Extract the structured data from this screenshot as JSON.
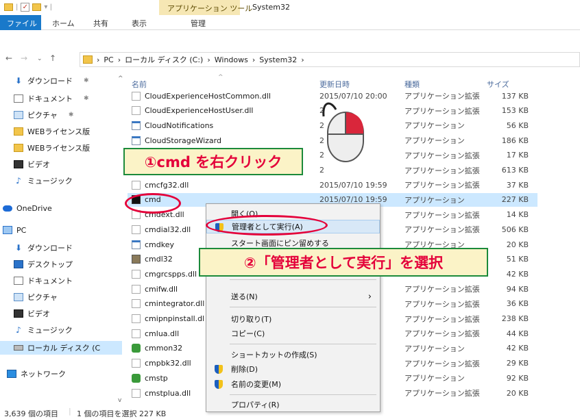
{
  "titlebar": {
    "context_tab": "アプリケーション ツール",
    "window_title": "System32"
  },
  "ribbon": {
    "tabs": [
      "ファイル",
      "ホーム",
      "共有",
      "表示",
      "管理"
    ]
  },
  "address": {
    "crumbs": [
      "PC",
      "ローカル ディスク (C:)",
      "Windows",
      "System32"
    ]
  },
  "sidebar": {
    "items": [
      {
        "label": "ダウンロード",
        "icon": "download-icon",
        "pinned": true
      },
      {
        "label": "ドキュメント",
        "icon": "document-icon",
        "pinned": true
      },
      {
        "label": "ピクチャ",
        "icon": "picture-icon",
        "pinned": true
      },
      {
        "label": "WEBライセンス版",
        "icon": "folder-icon",
        "pinned": false
      },
      {
        "label": "WEBライセンス版",
        "icon": "folder-icon",
        "pinned": false
      },
      {
        "label": "ビデオ",
        "icon": "video-icon",
        "pinned": false
      },
      {
        "label": "ミュージック",
        "icon": "music-icon",
        "pinned": false
      },
      {
        "label": "OneDrive",
        "icon": "onedrive-icon",
        "pinned": false
      },
      {
        "label": "PC",
        "icon": "pc-icon",
        "pinned": false
      },
      {
        "label": "ダウンロード",
        "icon": "download-icon",
        "pinned": false
      },
      {
        "label": "デスクトップ",
        "icon": "desktop-icon",
        "pinned": false
      },
      {
        "label": "ドキュメント",
        "icon": "document-icon",
        "pinned": false
      },
      {
        "label": "ピクチャ",
        "icon": "picture-icon",
        "pinned": false
      },
      {
        "label": "ビデオ",
        "icon": "video-icon",
        "pinned": false
      },
      {
        "label": "ミュージック",
        "icon": "music-icon",
        "pinned": false
      },
      {
        "label": "ローカル ディスク (C",
        "icon": "drive-icon",
        "pinned": false
      },
      {
        "label": "ネットワーク",
        "icon": "network-icon",
        "pinned": false
      }
    ]
  },
  "columns": {
    "name": "名前",
    "date": "更新日時",
    "type": "種類",
    "size": "サイズ"
  },
  "files": [
    {
      "name": "CloudExperienceHostCommon.dll",
      "date": "2015/07/10 20:00",
      "type": "アプリケーション拡張",
      "size": "137 KB",
      "icon": "dll"
    },
    {
      "name": "CloudExperienceHostUser.dll",
      "date": "2",
      "type": "アプリケーション拡張",
      "size": "153 KB",
      "icon": "dll"
    },
    {
      "name": "CloudNotifications",
      "date": "2",
      "type": "アプリケーション",
      "size": "56 KB",
      "icon": "app"
    },
    {
      "name": "CloudStorageWizard",
      "date": "2",
      "type": "アプリケーション",
      "size": "186 KB",
      "icon": "app"
    },
    {
      "name": "",
      "date": "2",
      "type": "アプリケーション拡張",
      "size": "17 KB",
      "icon": "dll"
    },
    {
      "name": "",
      "date": "2",
      "type": "アプリケーション拡張",
      "size": "613 KB",
      "icon": "dll"
    },
    {
      "name": "cmcfg32.dll",
      "date": "2015/07/10 19:59",
      "type": "アプリケーション拡張",
      "size": "37 KB",
      "icon": "dll"
    },
    {
      "name": "cmd",
      "date": "2015/07/10 19:59",
      "type": "アプリケーション",
      "size": "227 KB",
      "icon": "cmd",
      "selected": true
    },
    {
      "name": "cmdext.dll",
      "date": "",
      "type": "アプリケーション拡張",
      "size": "14 KB",
      "icon": "dll"
    },
    {
      "name": "cmdial32.dll",
      "date": "",
      "type": "アプリケーション拡張",
      "size": "506 KB",
      "icon": "dll"
    },
    {
      "name": "cmdkey",
      "date": "",
      "type": "アプリケーション",
      "size": "20 KB",
      "icon": "app"
    },
    {
      "name": "cmdl32",
      "date": "",
      "type": "",
      "size": "51 KB",
      "icon": "cpl"
    },
    {
      "name": "cmgrcspps.dll",
      "date": "",
      "type": "",
      "size": "42 KB",
      "icon": "dll"
    },
    {
      "name": "cmifw.dll",
      "date": "",
      "type": "アプリケーション拡張",
      "size": "94 KB",
      "icon": "dll"
    },
    {
      "name": "cmintegrator.dll",
      "date": "",
      "type": "アプリケーション拡張",
      "size": "36 KB",
      "icon": "dll"
    },
    {
      "name": "cmipnpinstall.dl",
      "date": "",
      "type": "アプリケーション拡張",
      "size": "238 KB",
      "icon": "dll"
    },
    {
      "name": "cmlua.dll",
      "date": "",
      "type": "アプリケーション拡張",
      "size": "44 KB",
      "icon": "dll"
    },
    {
      "name": "cmmon32",
      "date": "",
      "type": "アプリケーション",
      "size": "42 KB",
      "icon": "grn"
    },
    {
      "name": "cmpbk32.dll",
      "date": "",
      "type": "アプリケーション拡張",
      "size": "29 KB",
      "icon": "dll"
    },
    {
      "name": "cmstp",
      "date": "",
      "type": "アプリケーション",
      "size": "92 KB",
      "icon": "grn"
    },
    {
      "name": "cmstplua.dll",
      "date": "",
      "type": "アプリケーション拡張",
      "size": "20 KB",
      "icon": "dll"
    }
  ],
  "context_menu": {
    "open": "開く(O)",
    "run_as_admin": "管理者として実行(A)",
    "pin_start": "スタート画面にピン留めする",
    "send_to": "送る(N)",
    "cut": "切り取り(T)",
    "copy": "コピー(C)",
    "shortcut": "ショートカットの作成(S)",
    "delete": "削除(D)",
    "rename": "名前の変更(M)",
    "properties": "プロパティ(R)"
  },
  "callouts": {
    "step1": "①cmd を右クリック",
    "step2": "②「管理者として実行」を選択"
  },
  "status": {
    "count": "3,639 個の項目",
    "selected": "1 個の項目を選択 227 KB"
  },
  "colors": {
    "accent": "#1979ca",
    "highlight": "#e4003a",
    "callout_bg": "#fbf3c7",
    "callout_border": "#1b8a3a"
  }
}
